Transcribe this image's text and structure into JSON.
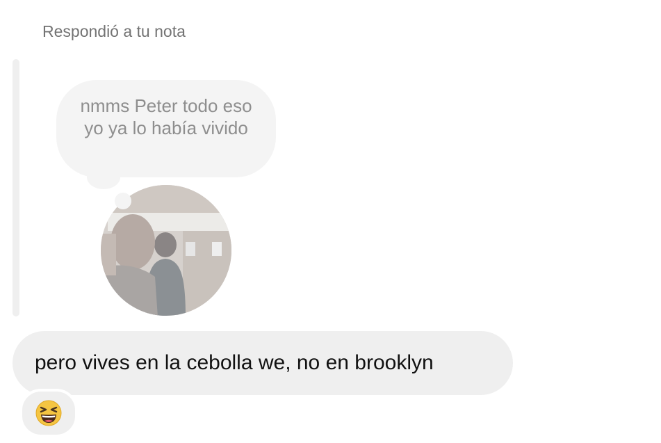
{
  "header": {
    "reply_label": "Respondió a tu nota"
  },
  "note": {
    "text": "nmms Peter todo eso yo ya lo había vivido"
  },
  "message": {
    "text": "pero vives en la cebolla we, no en brooklyn"
  },
  "reaction": {
    "emoji": "😆",
    "icon": "grinning-squinting-face-icon"
  },
  "colors": {
    "bubble": "#efefef",
    "note_bubble": "#f4f4f4",
    "note_text": "#8e8e8e",
    "label_text": "#737373",
    "message_text": "#111111",
    "emoji_face": "#f5c542"
  }
}
